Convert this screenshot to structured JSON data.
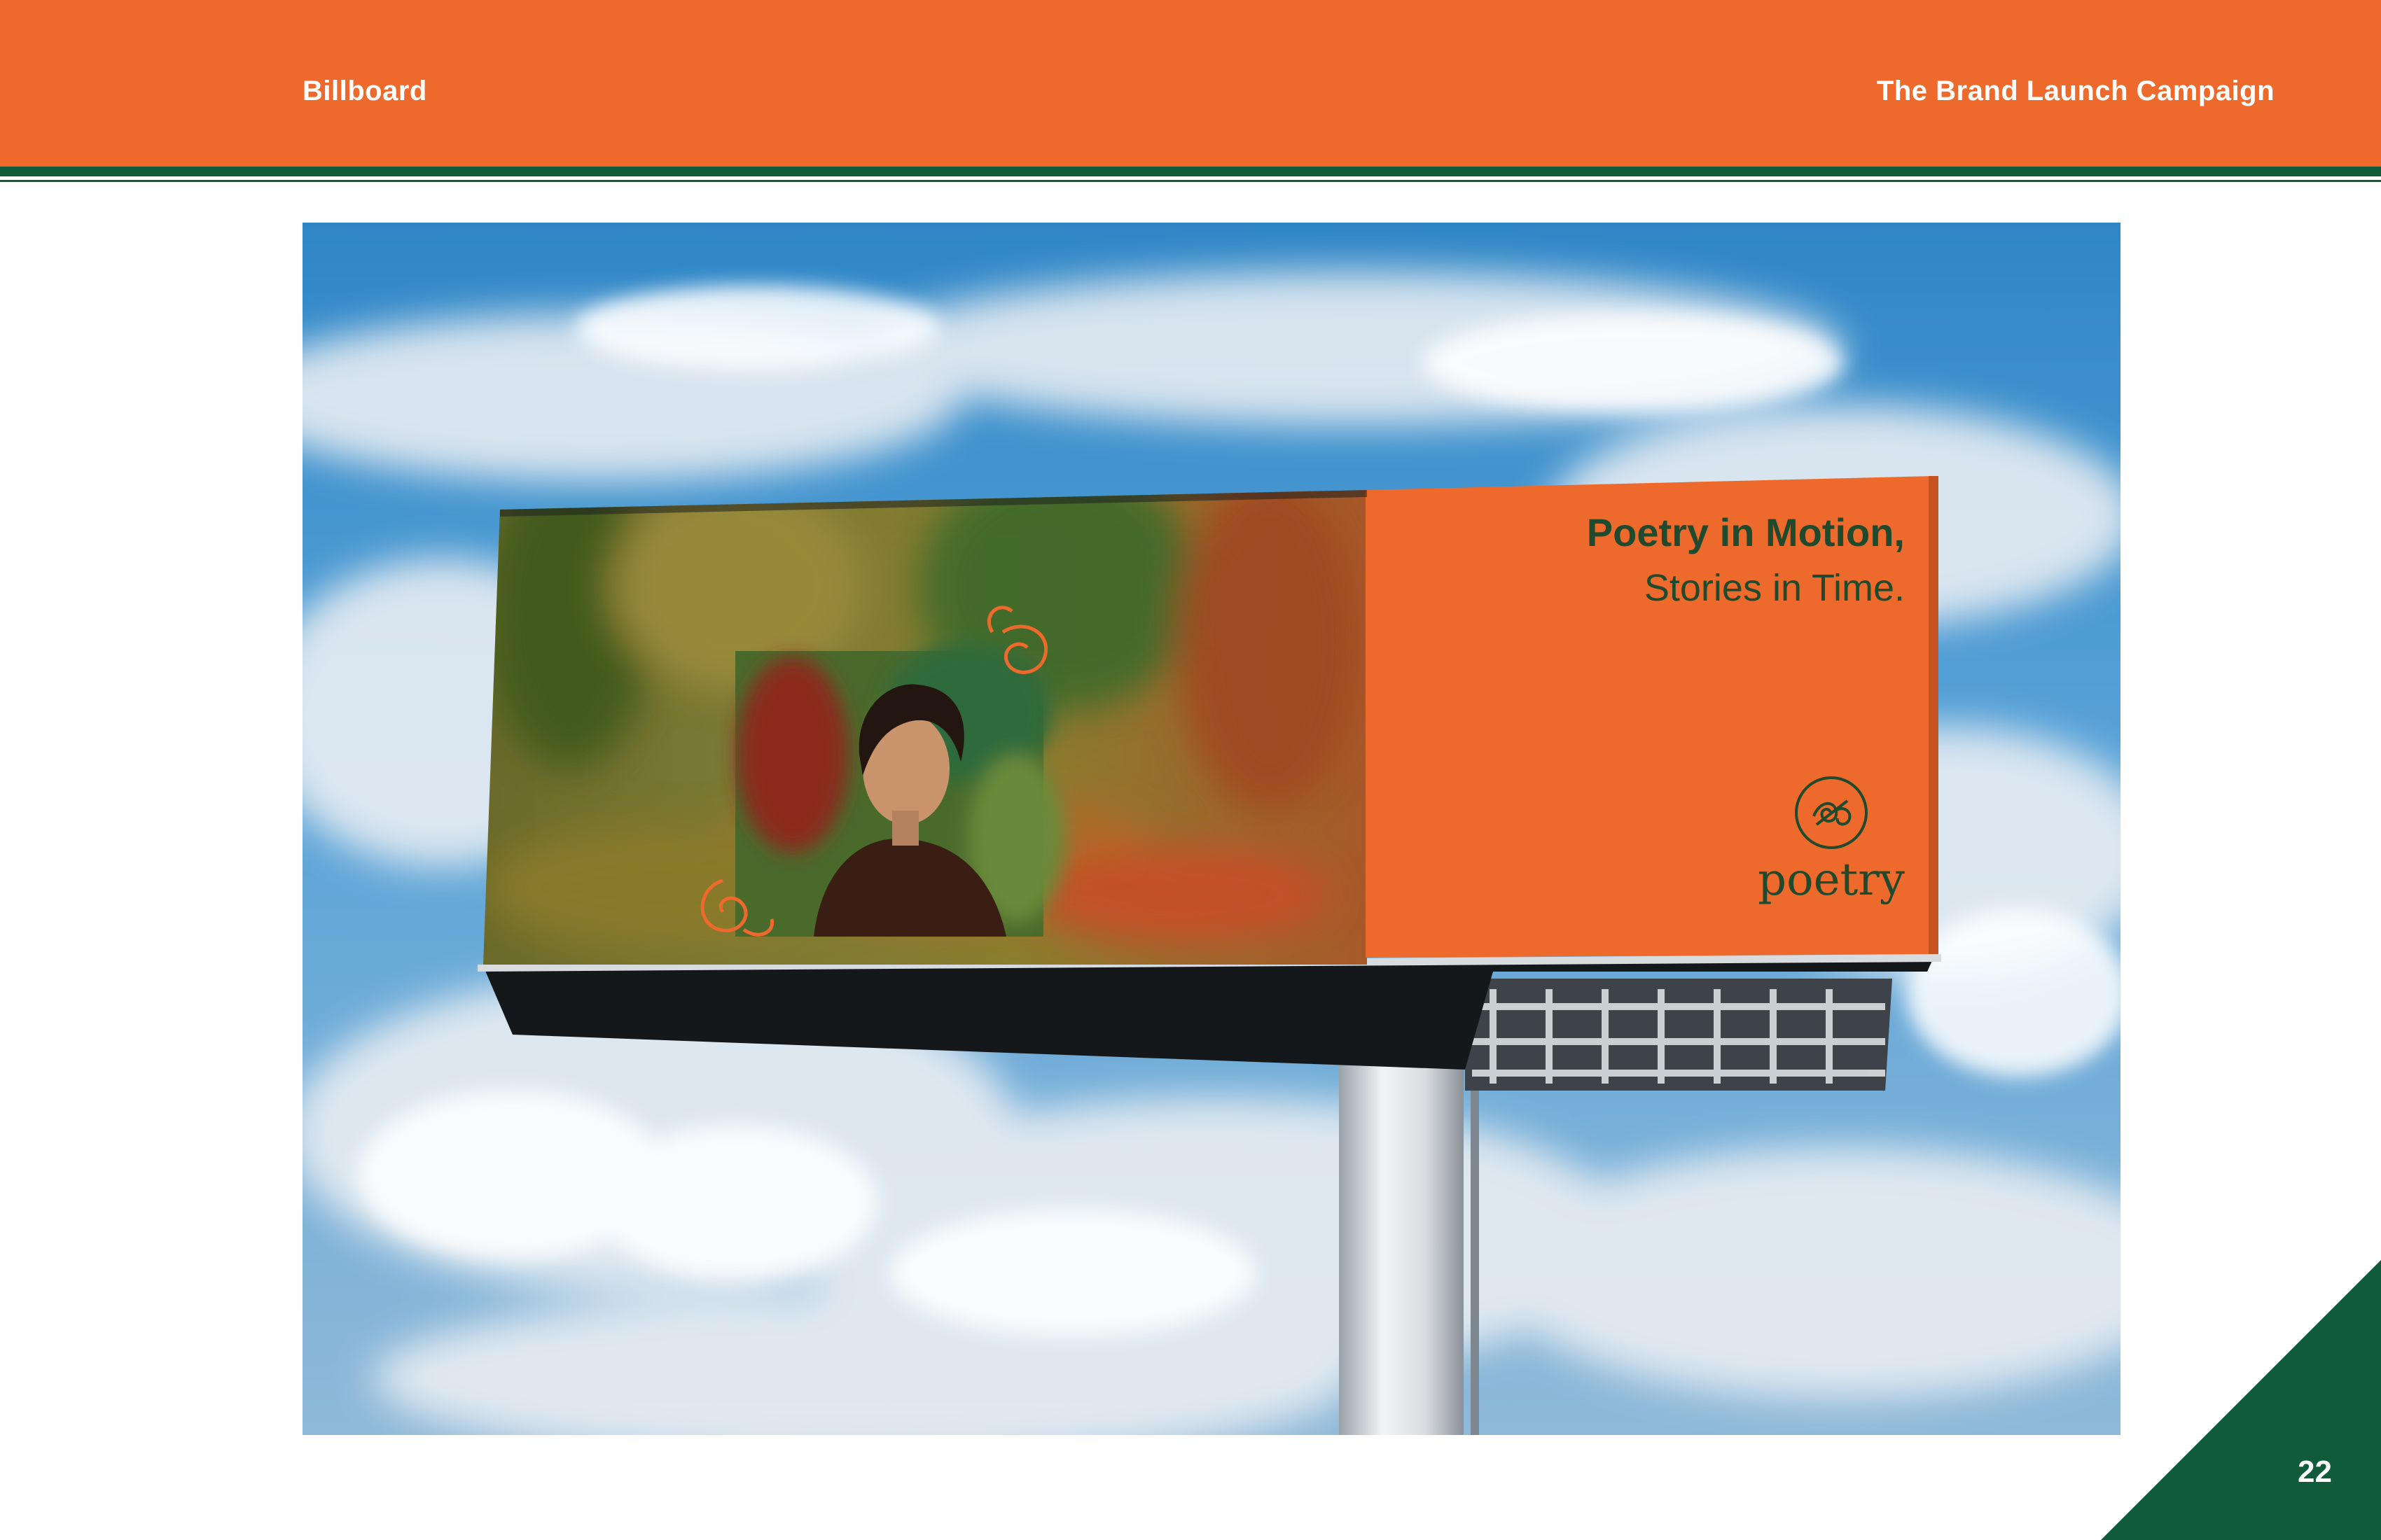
{
  "header": {
    "section_title": "Billboard",
    "campaign_title": "The Brand Launch Campaign"
  },
  "billboard": {
    "headline_line1": "Poetry in Motion,",
    "headline_line2": "Stories in Time.",
    "logo_wordmark": "poetry"
  },
  "footer": {
    "page_number": "22"
  },
  "colors": {
    "brand_orange": "#ee6a2c",
    "brand_green": "#0f5b3a",
    "billboard_text": "#1f4a2e"
  }
}
